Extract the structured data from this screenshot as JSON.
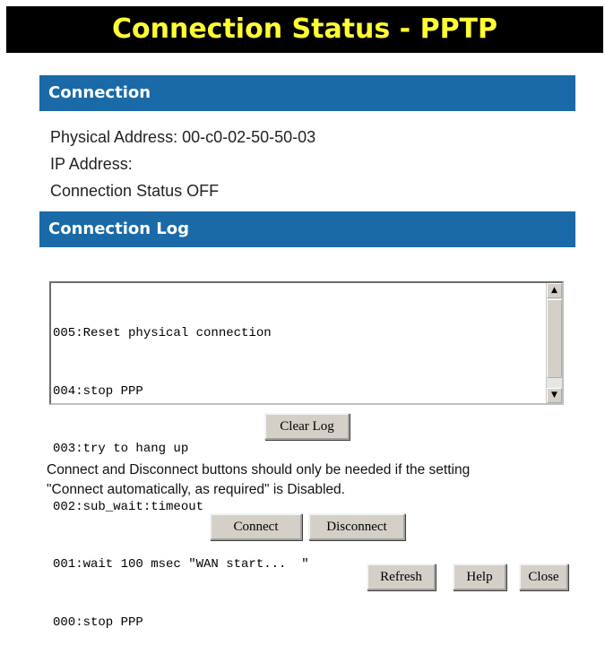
{
  "page": {
    "title": "Connection Status - PPTP"
  },
  "connection": {
    "header": "Connection",
    "physical_address": "Physical Address: 00-c0-02-50-50-03",
    "ip_address": "IP Address:",
    "status": "Connection Status OFF"
  },
  "log": {
    "header": "Connection Log",
    "lines": [
      "005:Reset physical connection",
      "004:stop PPP",
      "003:try to hang up",
      "002:sub_wait:timeout",
      "001:wait 100 msec \"WAN start...  \"",
      "000:stop PPP"
    ],
    "clear_label": "Clear Log"
  },
  "note": {
    "line1": "Connect and Disconnect buttons should only be needed if the setting",
    "line2": "\"Connect automatically, as required\" is Disabled."
  },
  "buttons": {
    "connect": "Connect",
    "disconnect": "Disconnect",
    "refresh": "Refresh",
    "help": "Help",
    "close": "Close"
  },
  "icons": {
    "scroll_up": "arrow-up-icon",
    "scroll_down": "arrow-down-icon"
  }
}
